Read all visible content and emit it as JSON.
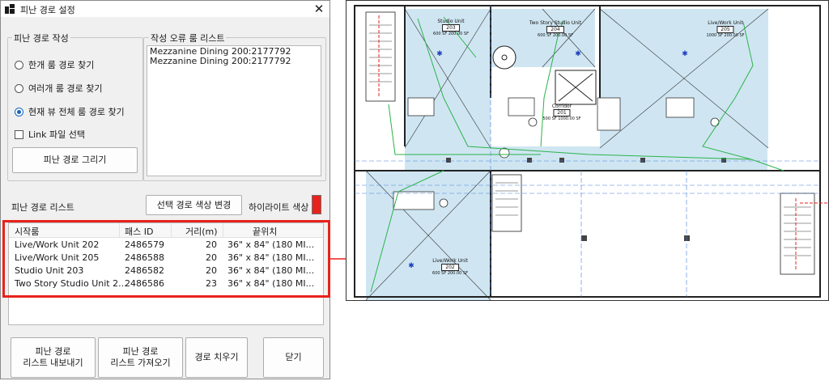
{
  "window": {
    "title": "피난 경로 설정",
    "close_glyph": "✕"
  },
  "create_group": {
    "label": "피난 경로 작성",
    "options": [
      {
        "label": "한개 룸 경로 찾기",
        "checked": false
      },
      {
        "label": "여러개 룸 경로 찾기",
        "checked": false
      },
      {
        "label": "현재 뷰 전체 룸 경로 찾기",
        "checked": true
      }
    ],
    "link_checkbox": {
      "label": "Link 파일 선택",
      "checked": false
    },
    "draw_button": "피난 경로 그리기"
  },
  "error_group": {
    "label": "작성 오류 룸 리스트",
    "items": [
      "Mezzanine Dining 200:2177792",
      "Mezzanine Dining 200:2177792"
    ]
  },
  "route_list": {
    "label": "피난 경로 리스트",
    "change_color_button": "선택 경로 색상 변경",
    "highlight_label": "하이라이트 색상",
    "highlight_color": "#e8221c",
    "columns": [
      "시작룸",
      "패스 ID",
      "거리(m)",
      "끝위치"
    ],
    "rows": [
      [
        "Live/Work Unit 202",
        "2486579",
        "20",
        "36\" x 84\" (180 MI..."
      ],
      [
        "Live/Work Unit 205",
        "2486588",
        "20",
        "36\" x 84\" (180 MI..."
      ],
      [
        "Studio Unit 203",
        "2486582",
        "20",
        "36\" x 84\" (180 MI..."
      ],
      [
        "Two Story Studio Unit 2...",
        "2486586",
        "23",
        "36\" x 84\" (180 MI..."
      ]
    ]
  },
  "bottom_buttons": {
    "export_line1": "피난 경로",
    "export_line2": "리스트 내보내기",
    "import_line1": "피난 경로",
    "import_line2": "리스트 가져오기",
    "clear": "경로 치우기",
    "close": "닫기"
  },
  "floor_plan": {
    "rooms": [
      {
        "name": "Studio Unit",
        "number": "203",
        "info": "600 SF  200.00 SF"
      },
      {
        "name": "Two Story Studio Unit",
        "number": "204",
        "info": "600 SF  200.00 SF"
      },
      {
        "name": "Live/Work Unit",
        "number": "205",
        "info": "1000 SF  200.00 SF"
      },
      {
        "name": "Corridor",
        "number": "201",
        "info": "500 SF  1000.00 SF"
      },
      {
        "name": "Live/Work Unit",
        "number": "202",
        "info": "600 SF  200.00 SF"
      }
    ],
    "colors": {
      "room_fill": "#cfe6f2",
      "route": "#2cb34a",
      "accent_red": "#e8221c",
      "marker": "#1f3fbf"
    }
  }
}
